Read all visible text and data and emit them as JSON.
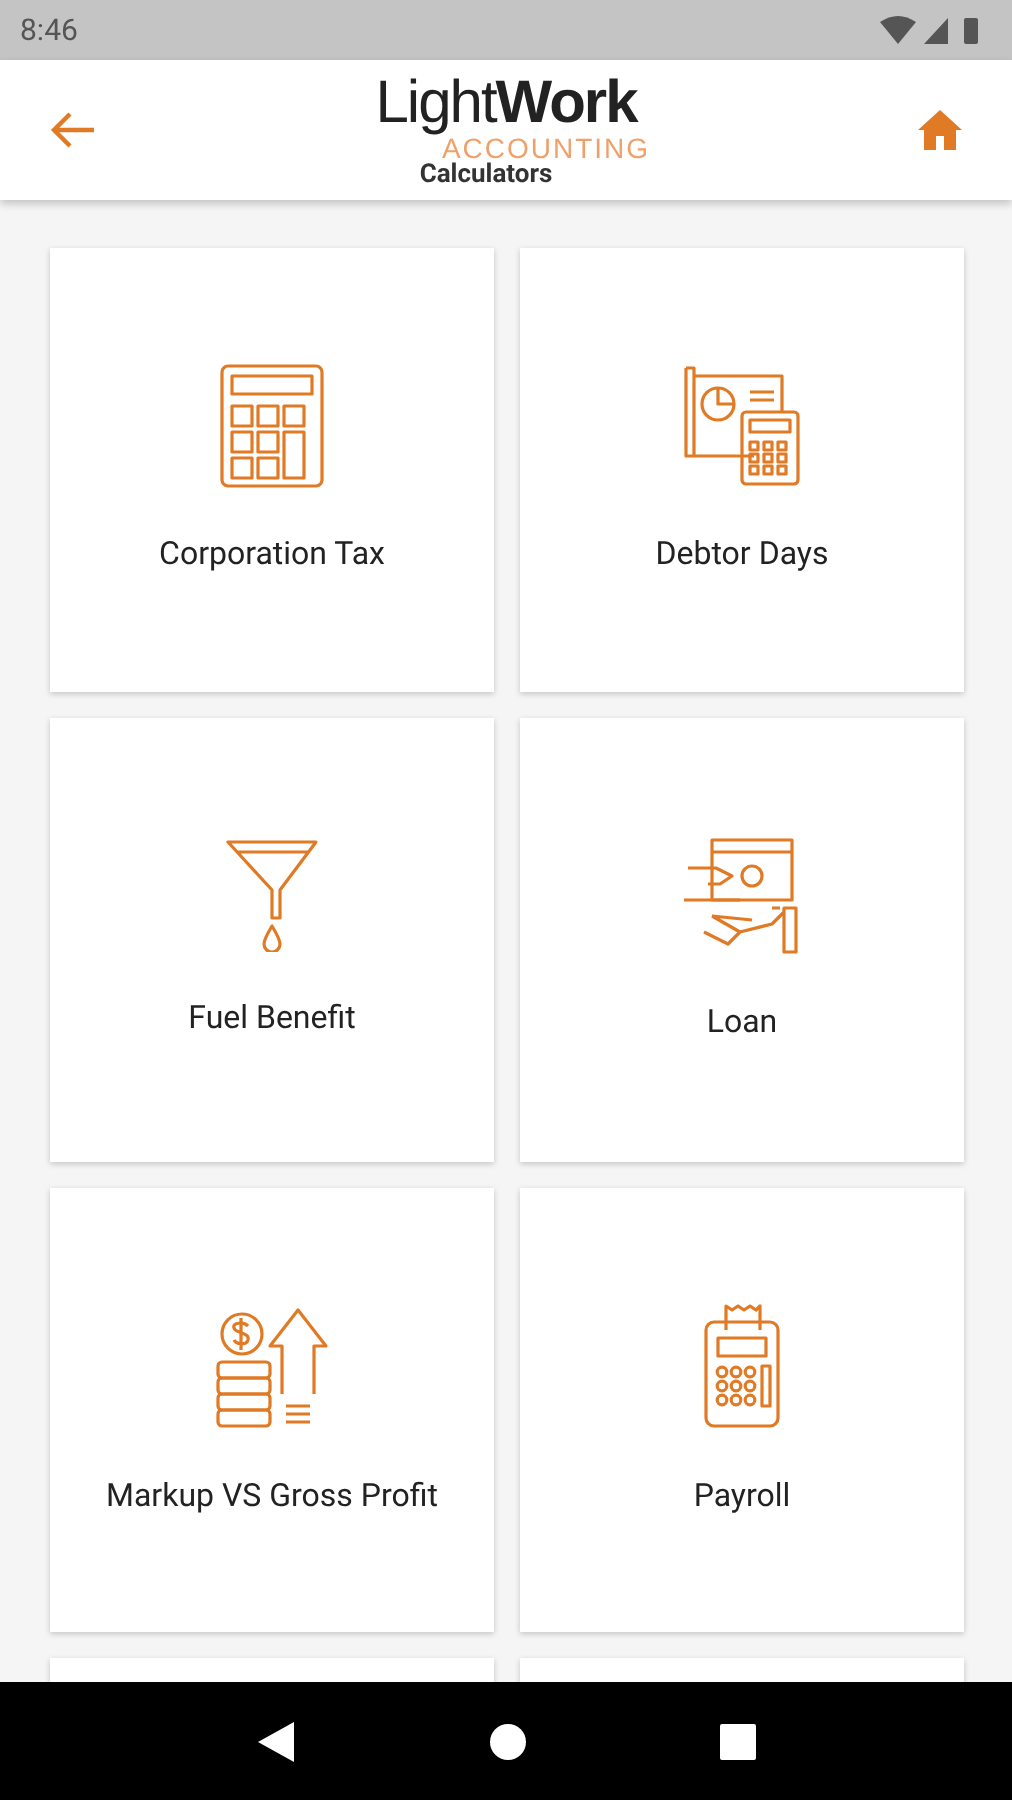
{
  "status_bar": {
    "time": "8:46"
  },
  "app_bar": {
    "logo": "Light**Work**",
    "logo_sub": "ACCOUNTING",
    "subtitle": "Calculators"
  },
  "cards": [
    {
      "kind": "calculator",
      "label": "Corporation Tax"
    },
    {
      "kind": "debtor",
      "label": "Debtor Days"
    },
    {
      "kind": "funnel",
      "label": "Fuel Benefit"
    },
    {
      "kind": "loan",
      "label": "Loan"
    },
    {
      "kind": "coins",
      "label": "Markup VS Gross Profit"
    },
    {
      "kind": "payroll",
      "label": "Payroll"
    },
    {
      "kind": "partial"
    },
    {
      "kind": "partial"
    }
  ]
}
